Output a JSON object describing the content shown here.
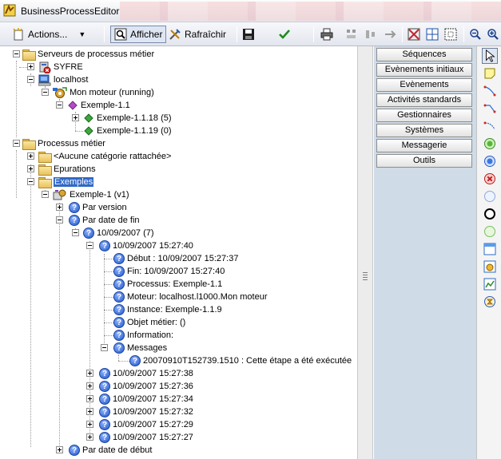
{
  "window": {
    "title": "BusinessProcessEditor"
  },
  "toolbar": {
    "actions_label": "Actions...",
    "afficher_label": "Afficher",
    "rafraichir_label": "Rafraîchir"
  },
  "tree": {
    "servers_root": "Serveurs de processus métier",
    "syfre": "SYFRE",
    "localhost": "localhost",
    "moteur": "Mon moteur (running)",
    "exemple_11": "Exemple-1.1",
    "exemple_1118": "Exemple-1.1.18 (5)",
    "exemple_1119": "Exemple-1.1.19 (0)",
    "processus_root": "Processus métier",
    "aucune": "<Aucune catégorie rattachée>",
    "epurations": "Epurations",
    "exemples": "Exemples",
    "exemple_v1": "Exemple-1 (v1)",
    "par_version": "Par version",
    "par_date_fin": "Par date de fin",
    "date_group": "10/09/2007 (7)",
    "item_1": "10/09/2007 15:27:40",
    "debut": "Début : 10/09/2007 15:27:37",
    "fin": "Fin: 10/09/2007 15:27:40",
    "processus": "Processus: Exemple-1.1",
    "moteur_detail": "Moteur: localhost.l1000.Mon moteur",
    "instance": "Instance: Exemple-1.1.9",
    "objet_metier": "Objet métier:  ()",
    "information": "Information:",
    "messages": "Messages",
    "message_1": "20070910T152739.1510 : Cette étape a été exécutée",
    "item_2": "10/09/2007 15:27:38",
    "item_3": "10/09/2007 15:27:36",
    "item_4": "10/09/2007 15:27:34",
    "item_5": "10/09/2007 15:27:32",
    "item_6": "10/09/2007 15:27:29",
    "item_7": "10/09/2007 15:27:27",
    "par_date_debut": "Par date de début"
  },
  "palette": {
    "buttons": [
      "Séquences",
      "Evènements initiaux",
      "Evènements",
      "Activités standards",
      "Gestionnaires",
      "Systèmes",
      "Messagerie",
      "Outils"
    ]
  },
  "colors": {
    "selection": "#3169c6",
    "palette_bg": "#cfdbe6",
    "title_tabs": "#f3c8c8"
  }
}
